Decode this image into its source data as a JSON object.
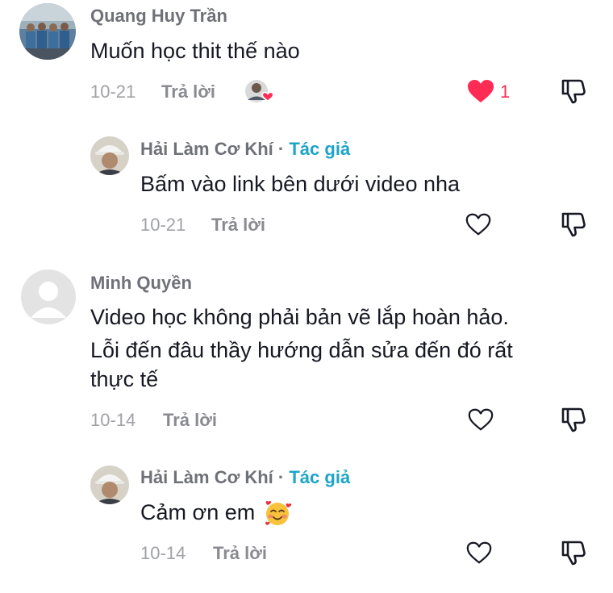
{
  "comments": [
    {
      "username": "Quang Huy Trần",
      "text": "Muốn học thit thế nào",
      "date": "10-21",
      "reply_label": "Trả lời",
      "likes": "1",
      "liked": true,
      "replies": [
        {
          "username": "Hải Làm Cơ Khí",
          "author_separator": "·",
          "author_tag": "Tác giả",
          "text": "Bấm vào link bên dưới video nha",
          "date": "10-21",
          "reply_label": "Trả lời",
          "liked": false
        }
      ]
    },
    {
      "username": "Minh Quyền",
      "text_lines": [
        "Video học không phải bản vẽ lắp hoàn hảo.",
        "Lỗi đến đâu thầy hướng dẫn sửa đến đó rất",
        "thực tế"
      ],
      "date": "10-14",
      "reply_label": "Trả lời",
      "liked": false,
      "replies": [
        {
          "username": "Hải Làm Cơ Khí",
          "author_separator": "·",
          "author_tag": "Tác giả",
          "text": "Cảm ơn em",
          "emoji": "smiling-face-with-hearts",
          "date": "10-14",
          "reply_label": "Trả lời",
          "liked": false
        }
      ]
    }
  ],
  "colors": {
    "like_active": "#fe2c55",
    "author_tag": "#1da4c7",
    "secondary_text": "#a1a2a7"
  }
}
